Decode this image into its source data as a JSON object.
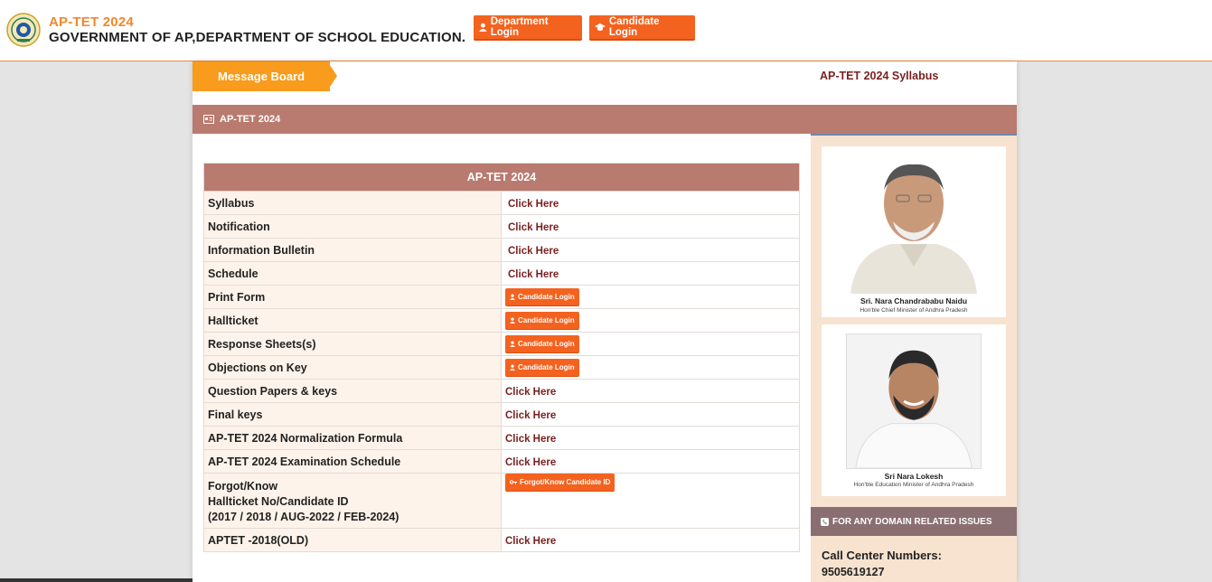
{
  "header": {
    "title": "AP-TET 2024",
    "subtitle": "GOVERNMENT OF AP,DEPARTMENT OF SCHOOL EDUCATION.",
    "department_login": "Department Login",
    "candidate_login": "Candidate Login"
  },
  "message_board": {
    "tab_label": "Message Board",
    "marquee_text": "AP-TET 2024 Syllabus"
  },
  "section": {
    "title": "AP-TET 2024"
  },
  "table": {
    "header": "AP-TET 2024",
    "rows": [
      {
        "label": "Syllabus",
        "action": "Click Here"
      },
      {
        "label": "Notification",
        "action": "Click Here"
      },
      {
        "label": "Information Bulletin",
        "action": "Click Here"
      },
      {
        "label": "Schedule",
        "action": "Click Here"
      },
      {
        "label": "Print Form",
        "action": "Candidate Login"
      },
      {
        "label": "Hallticket",
        "action": "Candidate Login"
      },
      {
        "label": "Response Sheets(s)",
        "action": "Candidate Login"
      },
      {
        "label": "Objections on Key",
        "action": "Candidate Login"
      },
      {
        "label": "Question Papers & keys",
        "action": "Click Here"
      },
      {
        "label": "Final keys",
        "action": "Click Here"
      },
      {
        "label": "AP-TET 2024 Normalization Formula",
        "action": "Click Here"
      },
      {
        "label": "AP-TET 2024 Examination Schedule",
        "action": "Click Here"
      },
      {
        "label_line1": "Forgot/Know",
        "label_line2": "Hallticket No/Candidate ID",
        "label_line3": "(2017 / 2018 / AUG-2022 / FEB-2024)",
        "action": "Forgot/Know Candidate ID"
      },
      {
        "label": "APTET -2018(OLD)",
        "action": "Click Here"
      }
    ]
  },
  "sidebar": {
    "person1_name": "Sri. Nara Chandrababu Naidu",
    "person1_role": "Hon'ble Chief Minister of Andhra Pradesh",
    "person2_name": "Sri Nara Lokesh",
    "person2_role": "Hon'ble Education Minister of Andhra Pradesh",
    "domain_issues": "FOR ANY DOMAIN RELATED ISSUES",
    "call_center_title": "Call Center Numbers:",
    "call_center_number": "9505619127"
  },
  "colors": {
    "accent_orange": "#f4621f",
    "tab_orange": "#f99b1c",
    "section_brown": "#b97a6f",
    "link_maroon": "#7a1f1f"
  }
}
